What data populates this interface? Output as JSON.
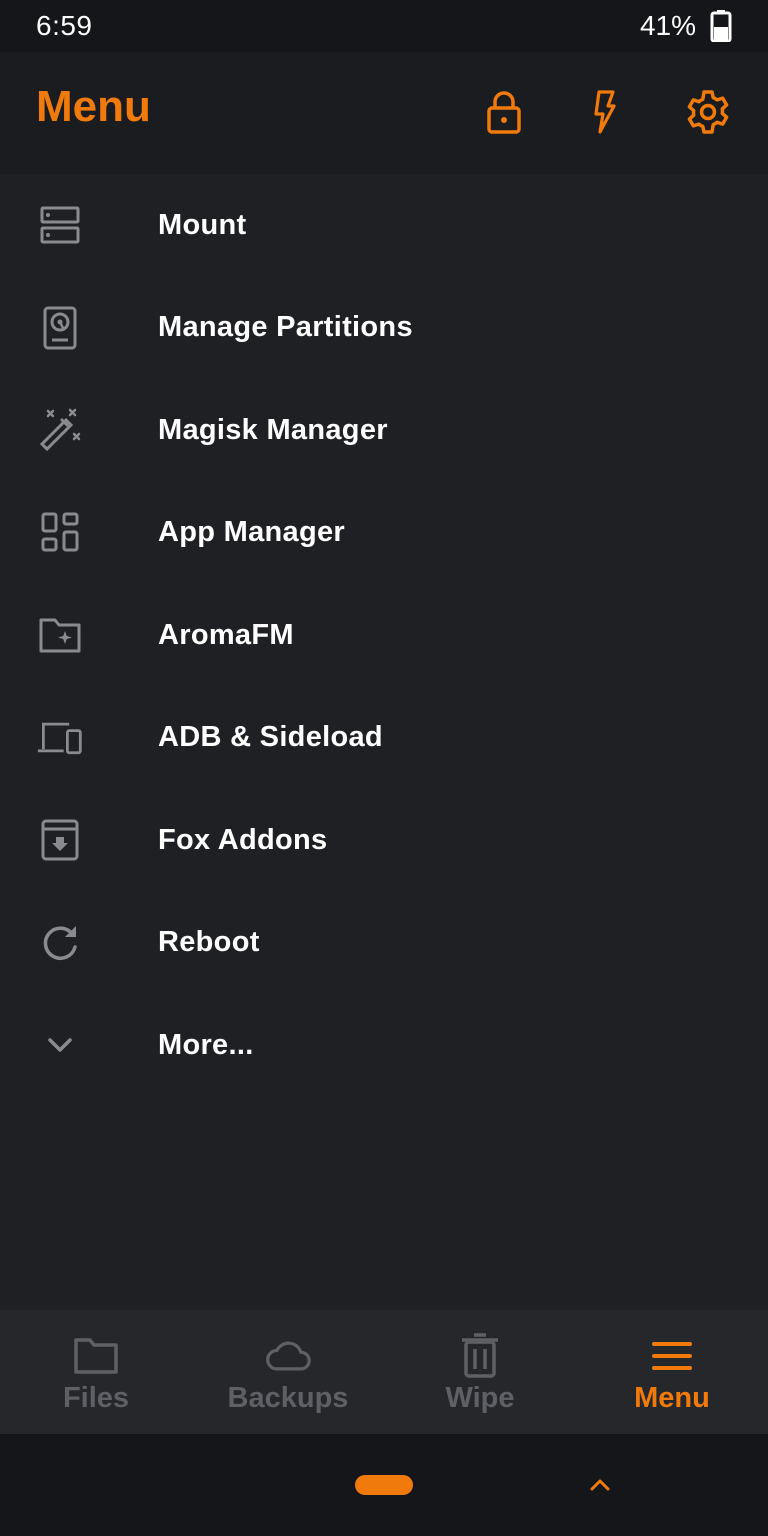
{
  "status_bar": {
    "time": "6:59",
    "battery": "41%"
  },
  "app_bar": {
    "title": "Menu",
    "actions": [
      "lock-icon",
      "flash-icon",
      "settings-icon"
    ]
  },
  "menu": {
    "items": [
      {
        "label": "Mount",
        "icon": "storage-icon"
      },
      {
        "label": "Manage Partitions",
        "icon": "hard-drive-icon"
      },
      {
        "label": "Magisk Manager",
        "icon": "magic-wand-icon"
      },
      {
        "label": "App Manager",
        "icon": "dashboard-icon"
      },
      {
        "label": "AromaFM",
        "icon": "folder-special-icon"
      },
      {
        "label": "ADB & Sideload",
        "icon": "devices-icon"
      },
      {
        "label": "Fox Addons",
        "icon": "archive-icon"
      },
      {
        "label": "Reboot",
        "icon": "refresh-icon"
      },
      {
        "label": "More...",
        "icon": "chevron-down-icon"
      }
    ]
  },
  "bottom_nav": {
    "items": [
      {
        "label": "Files",
        "icon": "folder-icon",
        "active": false
      },
      {
        "label": "Backups",
        "icon": "cloud-icon",
        "active": false
      },
      {
        "label": "Wipe",
        "icon": "trash-icon",
        "active": false
      },
      {
        "label": "Menu",
        "icon": "hamburger-menu-icon",
        "active": true
      }
    ]
  },
  "colors": {
    "accent": "#f07a0c",
    "background": "#1f2024",
    "inactive": "#5f6065",
    "icon_gray": "#8a8b90"
  }
}
